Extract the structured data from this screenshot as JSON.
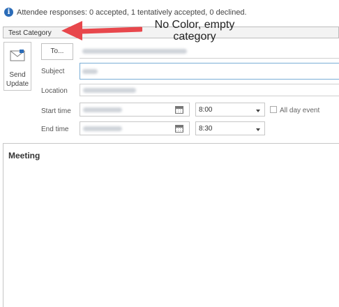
{
  "info_bar": {
    "icon": "info-icon",
    "text": "Attendee responses: 0 accepted, 1 tentatively accepted, 0 declined."
  },
  "category_bar": {
    "label": "Test Category"
  },
  "annotation": {
    "text": "No Color, empty category",
    "arrow_color": "#e8474c"
  },
  "send": {
    "label": "Send Update",
    "icon": "envelope-send-icon"
  },
  "to": {
    "button_label": "To...",
    "value": ""
  },
  "subject": {
    "label": "Subject",
    "value": ""
  },
  "location": {
    "label": "Location",
    "value": ""
  },
  "start": {
    "label": "Start time",
    "date": "",
    "time": "8:00"
  },
  "end": {
    "label": "End time",
    "date": "",
    "time": "8:30"
  },
  "all_day": {
    "label": "All day event",
    "checked": false
  },
  "body": {
    "text": "Meeting"
  },
  "colors": {
    "accent": "#2b6cb8",
    "annotation_arrow": "#e8474c"
  }
}
